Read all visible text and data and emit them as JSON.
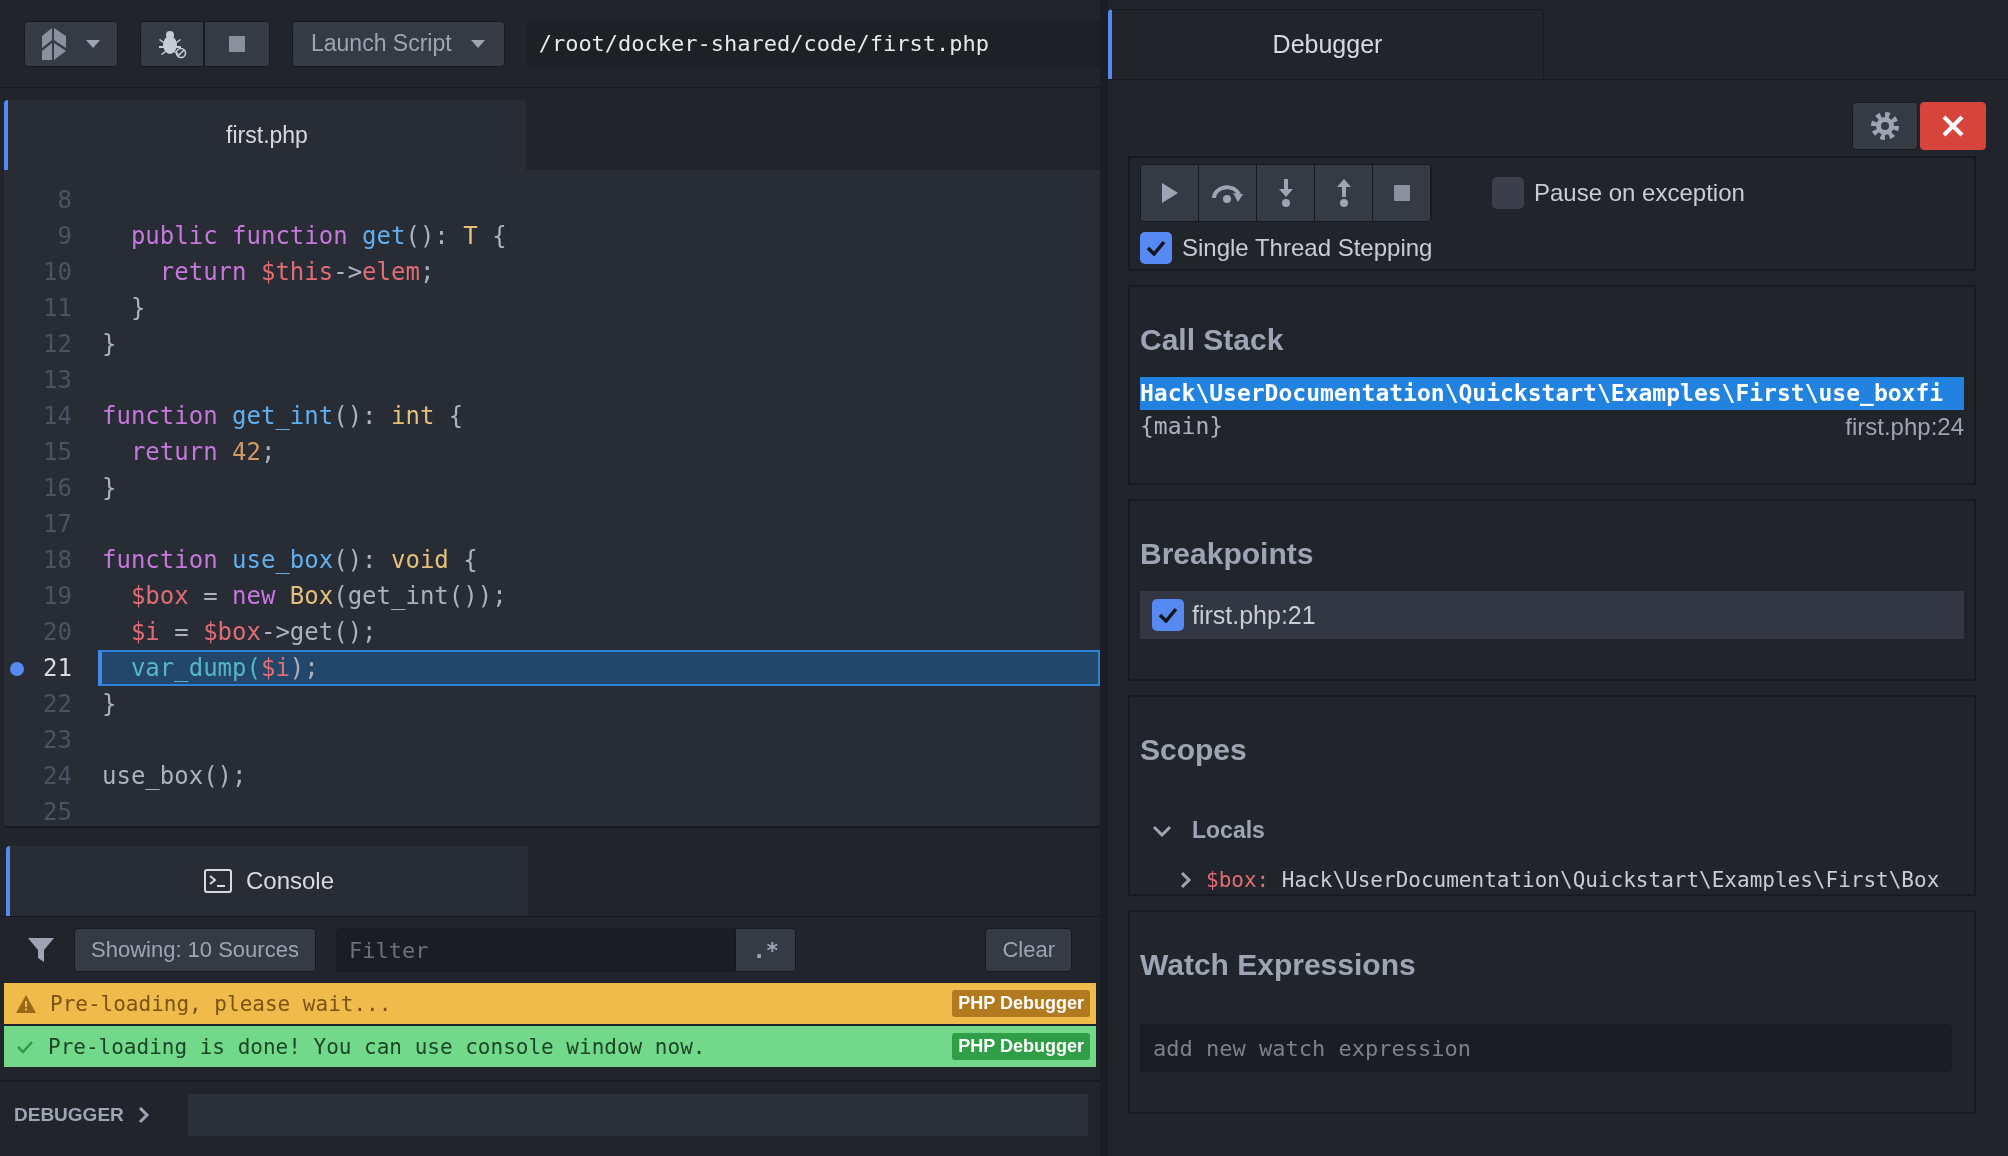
{
  "toolbar": {
    "launch_button": "Launch Script",
    "path": "/root/docker-shared/code/first.php"
  },
  "editor": {
    "tab": "first.php",
    "lines": [
      {
        "number": "8",
        "breakpoint": false,
        "current": false
      },
      {
        "number": "9",
        "breakpoint": false,
        "current": false,
        "code": [
          {
            "kind": "keyword",
            "text": "  public function "
          },
          {
            "kind": "function",
            "text": "get"
          },
          {
            "kind": "plain",
            "text": "(): "
          },
          {
            "kind": "type",
            "text": "T"
          },
          {
            "kind": "plain",
            "text": " {"
          }
        ]
      },
      {
        "number": "10",
        "breakpoint": false,
        "current": false,
        "code": [
          {
            "kind": "keyword",
            "text": "    return "
          },
          {
            "kind": "variable",
            "text": "$this"
          },
          {
            "kind": "plain",
            "text": "->"
          },
          {
            "kind": "variable",
            "text": "elem"
          },
          {
            "kind": "plain",
            "text": ";"
          }
        ]
      },
      {
        "number": "11",
        "breakpoint": false,
        "current": false,
        "code": [
          {
            "kind": "plain",
            "text": "  }"
          }
        ]
      },
      {
        "number": "12",
        "breakpoint": false,
        "current": false,
        "code": [
          {
            "kind": "plain",
            "text": "}"
          }
        ]
      },
      {
        "number": "13",
        "breakpoint": false,
        "current": false
      },
      {
        "number": "14",
        "breakpoint": false,
        "current": false,
        "code": [
          {
            "kind": "keyword",
            "text": "function "
          },
          {
            "kind": "function",
            "text": "get_int"
          },
          {
            "kind": "plain",
            "text": "(): "
          },
          {
            "kind": "type",
            "text": "int"
          },
          {
            "kind": "plain",
            "text": " {"
          }
        ]
      },
      {
        "number": "15",
        "breakpoint": false,
        "current": false,
        "code": [
          {
            "kind": "keyword",
            "text": "  return "
          },
          {
            "kind": "number",
            "text": "42"
          },
          {
            "kind": "plain",
            "text": ";"
          }
        ]
      },
      {
        "number": "16",
        "breakpoint": false,
        "current": false,
        "code": [
          {
            "kind": "plain",
            "text": "}"
          }
        ]
      },
      {
        "number": "17",
        "breakpoint": false,
        "current": false
      },
      {
        "number": "18",
        "breakpoint": false,
        "current": false,
        "code": [
          {
            "kind": "keyword",
            "text": "function "
          },
          {
            "kind": "function",
            "text": "use_box"
          },
          {
            "kind": "plain",
            "text": "(): "
          },
          {
            "kind": "type",
            "text": "void"
          },
          {
            "kind": "plain",
            "text": " {"
          }
        ]
      },
      {
        "number": "19",
        "breakpoint": false,
        "current": false,
        "code": [
          {
            "kind": "variable",
            "text": "  $box"
          },
          {
            "kind": "plain",
            "text": " = "
          },
          {
            "kind": "keyword",
            "text": "new "
          },
          {
            "kind": "type",
            "text": "Box"
          },
          {
            "kind": "plain",
            "text": "(get_int());"
          }
        ]
      },
      {
        "number": "20",
        "breakpoint": false,
        "current": false,
        "code": [
          {
            "kind": "variable",
            "text": "  $i"
          },
          {
            "kind": "plain",
            "text": " = "
          },
          {
            "kind": "variable",
            "text": "$box"
          },
          {
            "kind": "plain",
            "text": "->get();"
          }
        ]
      },
      {
        "number": "21",
        "breakpoint": true,
        "current": true,
        "code": [
          {
            "kind": "call",
            "text": "  var_dump("
          },
          {
            "kind": "variable",
            "text": "$i"
          },
          {
            "kind": "plain",
            "text": ");"
          }
        ]
      },
      {
        "number": "22",
        "breakpoint": false,
        "current": false,
        "code": [
          {
            "kind": "plain",
            "text": "}"
          }
        ]
      },
      {
        "number": "23",
        "breakpoint": false,
        "current": false
      },
      {
        "number": "24",
        "breakpoint": false,
        "current": false,
        "code": [
          {
            "kind": "plain",
            "text": "use_box();"
          }
        ]
      },
      {
        "number": "25",
        "breakpoint": false,
        "current": false
      }
    ]
  },
  "console": {
    "tab": "Console",
    "sources_button": "Showing: 10 Sources",
    "filter": {
      "placeholder": "Filter"
    },
    "regex_button": ".*",
    "clear_button": "Clear",
    "messages": [
      {
        "kind": "warning",
        "text": "Pre-loading, please wait...",
        "source": "PHP Debugger"
      },
      {
        "kind": "success",
        "text": "Pre-loading is done! You can use console window now.",
        "source": "PHP Debugger"
      }
    ]
  },
  "debugger_bar": {
    "label": "DEBUGGER"
  },
  "debugger": {
    "tab": "Debugger",
    "pause_on_exception": {
      "label": "Pause on exception",
      "checked": false
    },
    "single_thread": {
      "label": "Single Thread Stepping",
      "checked": true
    },
    "call_stack": {
      "title": "Call Stack",
      "frames": [
        {
          "function": "Hack\\UserDocumentation\\Quickstart\\Examples\\First\\use_boxfi",
          "selected": true
        },
        {
          "function": "{main}",
          "location": "first.php:24",
          "selected": false
        }
      ]
    },
    "breakpoints": {
      "title": "Breakpoints",
      "items": [
        {
          "label": "first.php:21",
          "checked": true
        }
      ]
    },
    "scopes": {
      "title": "Scopes",
      "groups": [
        {
          "label": "Locals",
          "expanded": true,
          "children": [
            {
              "name": "$box:",
              "value": "Hack\\UserDocumentation\\Quickstart\\Examples\\First\\Box",
              "expanded": false
            }
          ]
        }
      ]
    },
    "watch": {
      "title": "Watch Expressions",
      "input": {
        "placeholder": "add new watch expression"
      }
    }
  }
}
